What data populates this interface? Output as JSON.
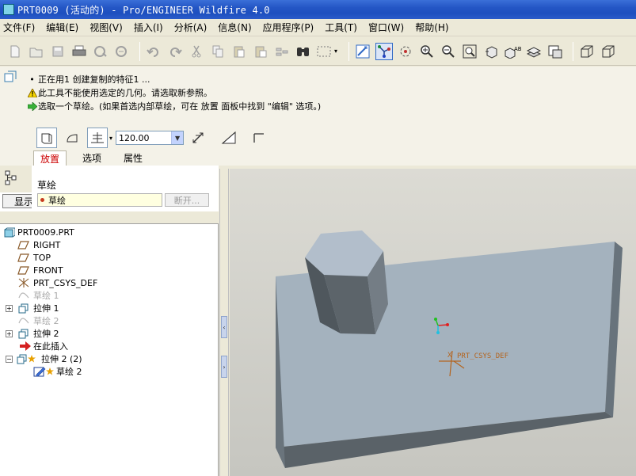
{
  "window": {
    "title": "PRT0009 (活动的) - Pro/ENGINEER Wildfire 4.0"
  },
  "menu": {
    "items": [
      "文件(F)",
      "编辑(E)",
      "视图(V)",
      "插入(I)",
      "分析(A)",
      "信息(N)",
      "应用程序(P)",
      "工具(T)",
      "窗口(W)",
      "帮助(H)"
    ]
  },
  "messages": {
    "line1": "正在用1 创建复制的特征1 ...",
    "line2": "此工具不能使用选定的几何。请选取新参照。",
    "line3": "选取一个草绘。(如果首选内部草绘，可在 放置 面板中找到 \"编辑\" 选项。)"
  },
  "dashboard": {
    "depth_value": "120.00",
    "tabs": [
      "放置",
      "选项",
      "属性"
    ]
  },
  "placement": {
    "label": "草绘",
    "field_value": "草绘",
    "button_label": "断开..."
  },
  "panel": {
    "show_label": "显示"
  },
  "tree": {
    "items": [
      {
        "label": "PRT0009.PRT"
      },
      {
        "label": "RIGHT"
      },
      {
        "label": "TOP"
      },
      {
        "label": "FRONT"
      },
      {
        "label": "PRT_CSYS_DEF"
      },
      {
        "label": "草绘 1"
      },
      {
        "label": "拉伸 1"
      },
      {
        "label": "草绘 2"
      },
      {
        "label": "拉伸 2"
      },
      {
        "label": "在此插入"
      },
      {
        "label": "拉伸 2 (2)"
      },
      {
        "label": "草绘 2"
      }
    ]
  },
  "viewport": {
    "csys_label": "PRT_CSYS_DEF",
    "csys_axis_label": "X"
  },
  "colors": {
    "title_bar": "#2456c5",
    "model_top": "#a3b1bd",
    "model_side": "#5a6268",
    "active_tab": "#cc0000",
    "csys_color": "#b4641e"
  }
}
